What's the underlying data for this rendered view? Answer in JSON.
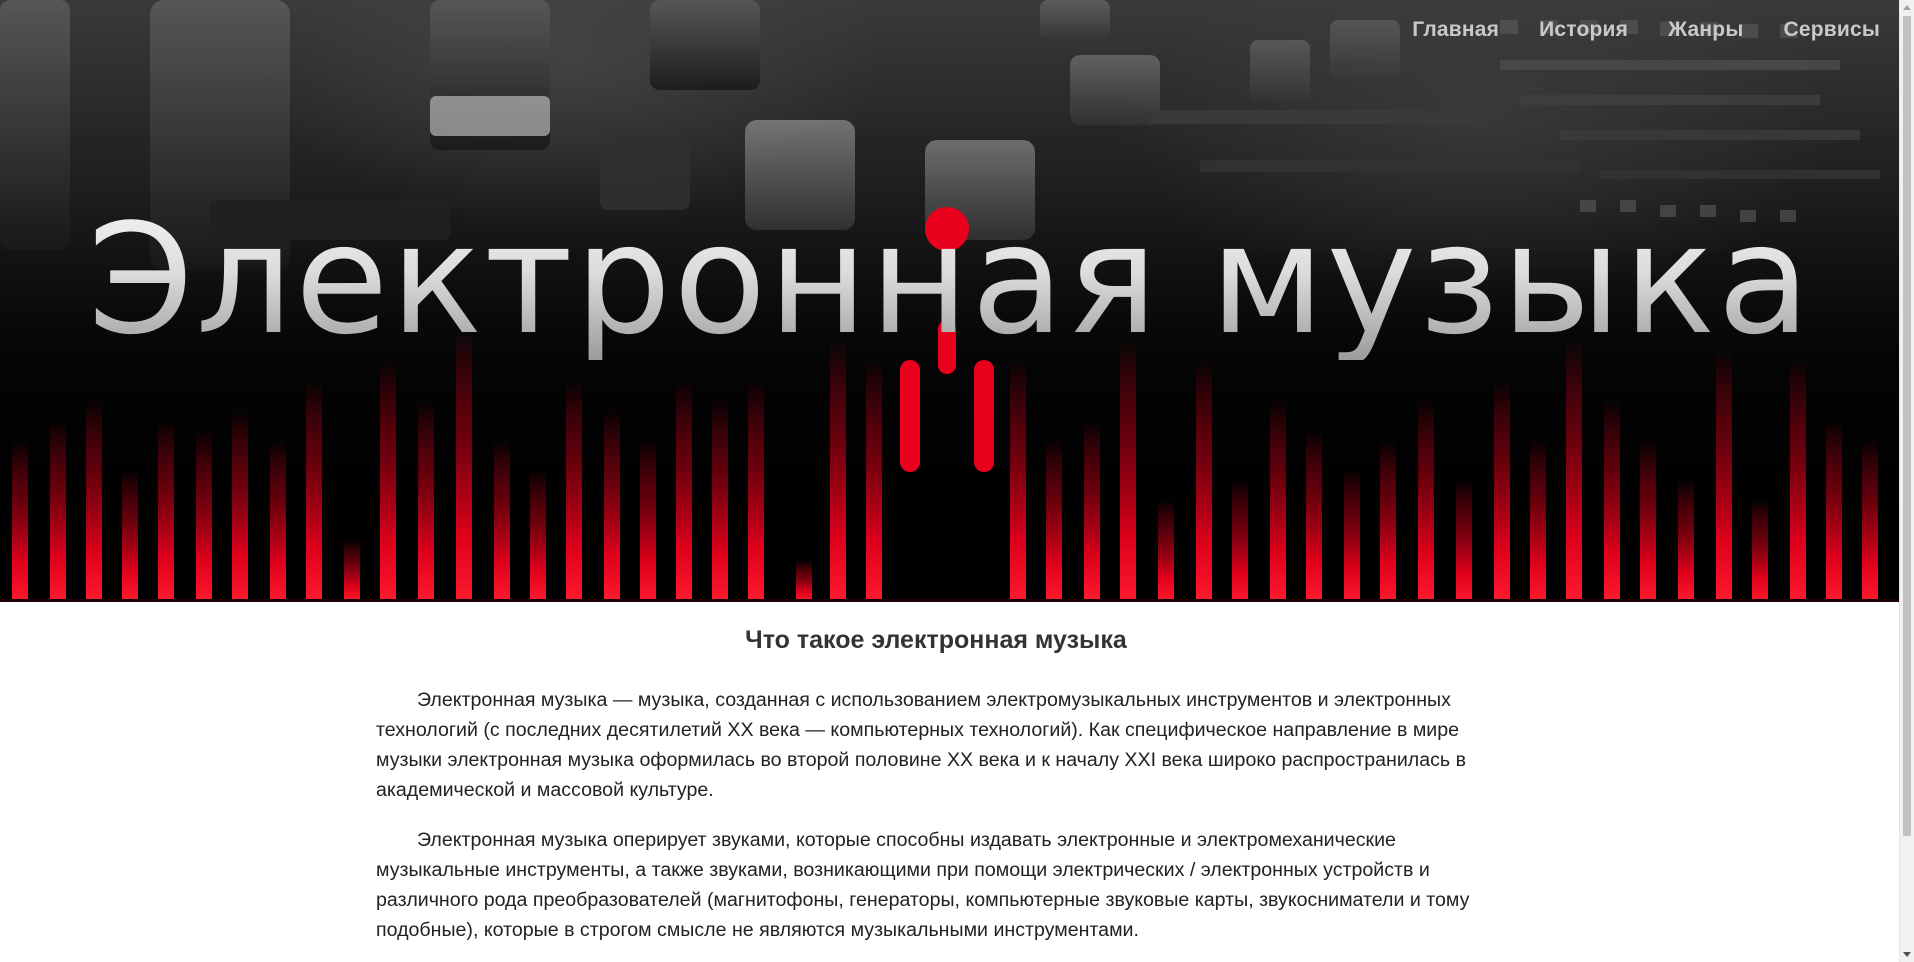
{
  "nav": {
    "items": [
      {
        "label": "Главная"
      },
      {
        "label": "История"
      },
      {
        "label": "Жанры"
      },
      {
        "label": "Сервисы"
      }
    ]
  },
  "hero": {
    "title": "Электронная музыка",
    "accent_color": "#e8001c",
    "background_image": "mixing-console-photo"
  },
  "article": {
    "heading": "Что такое электронная музыка",
    "paragraphs": [
      "Электронная музыка — музыка, созданная с использованием электромузыкальных инструментов и электронных технологий (с последних десятилетий XX века — компьютерных технологий). Как специфическое направление в мире музыки электронная музыка оформилась во второй половине XX века и к началу XXI века широко распространилась в академической и массовой культуре.",
      "Электронная музыка оперирует звуками, которые способны издавать электронные и электромеханические музыкальные инструменты, а также звуками, возникающими при помощи электрических / электронных устройств и различного рода преобразователей (магнитофоны, генераторы, компьютерные звуковые карты, звукосниматели и тому подобные), которые в строгом смысле не являются музыкальными инструментами."
    ]
  }
}
